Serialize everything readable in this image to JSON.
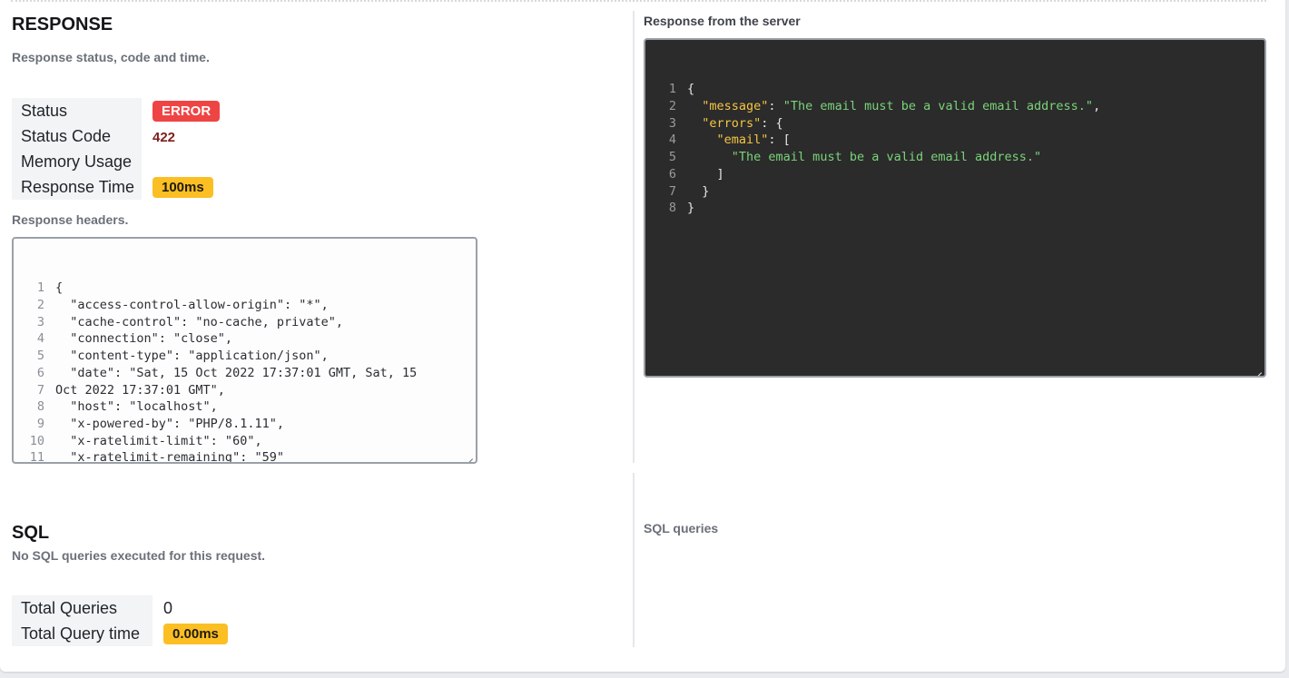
{
  "response": {
    "title": "RESPONSE",
    "subtitle": "Response status, code and time.",
    "fields": {
      "status_label": "Status",
      "status_value": "ERROR",
      "code_label": "Status Code",
      "code_value": "422",
      "memory_label": "Memory Usage",
      "memory_value": "",
      "time_label": "Response Time",
      "time_value": "100ms"
    },
    "headers_label": "Response headers.",
    "headers_lines": [
      {
        "n": "1",
        "t": "{"
      },
      {
        "n": "2",
        "t": "  \"access-control-allow-origin\": \"*\","
      },
      {
        "n": "3",
        "t": "  \"cache-control\": \"no-cache, private\","
      },
      {
        "n": "4",
        "t": "  \"connection\": \"close\","
      },
      {
        "n": "5",
        "t": "  \"content-type\": \"application/json\","
      },
      {
        "n": "6",
        "t": "  \"date\": \"Sat, 15 Oct 2022 17:37:01 GMT, Sat, 15"
      },
      {
        "n": "7",
        "t": "Oct 2022 17:37:01 GMT\","
      },
      {
        "n": "8",
        "t": "  \"host\": \"localhost\","
      },
      {
        "n": "9",
        "t": "  \"x-powered-by\": \"PHP/8.1.11\","
      },
      {
        "n": "10",
        "t": "  \"x-ratelimit-limit\": \"60\","
      },
      {
        "n": "11",
        "t": "  \"x-ratelimit-remaining\": \"59\""
      },
      {
        "n": "",
        "t": "}"
      }
    ]
  },
  "server": {
    "title": "Response from the server",
    "lines": [
      {
        "n": "1",
        "pre": "{",
        "key": "",
        "mid": "",
        "str": "",
        "post": ""
      },
      {
        "n": "2",
        "pre": "  ",
        "key": "\"message\"",
        "mid": ": ",
        "str": "\"The email must be a valid email address.\"",
        "post": ","
      },
      {
        "n": "3",
        "pre": "  ",
        "key": "\"errors\"",
        "mid": ": {",
        "str": "",
        "post": ""
      },
      {
        "n": "4",
        "pre": "    ",
        "key": "\"email\"",
        "mid": ": [",
        "str": "",
        "post": ""
      },
      {
        "n": "5",
        "pre": "      ",
        "key": "",
        "mid": "",
        "str": "\"The email must be a valid email address.\"",
        "post": ""
      },
      {
        "n": "6",
        "pre": "    ]",
        "key": "",
        "mid": "",
        "str": "",
        "post": ""
      },
      {
        "n": "7",
        "pre": "  }",
        "key": "",
        "mid": "",
        "str": "",
        "post": ""
      },
      {
        "n": "8",
        "pre": "}",
        "key": "",
        "mid": "",
        "str": "",
        "post": ""
      }
    ]
  },
  "sql": {
    "title": "SQL",
    "subtitle": "No SQL queries executed for this request.",
    "total_queries_label": "Total Queries",
    "total_queries_value": "0",
    "total_time_label": "Total Query time",
    "total_time_value": "0.00ms",
    "queries_label": "SQL queries"
  },
  "colors": {
    "error_badge": "#ef4444",
    "warning_badge": "#fbbf24",
    "code_key": "#f5c542",
    "code_string": "#7ad37a",
    "editor_dark_bg": "#2b2b2b"
  }
}
